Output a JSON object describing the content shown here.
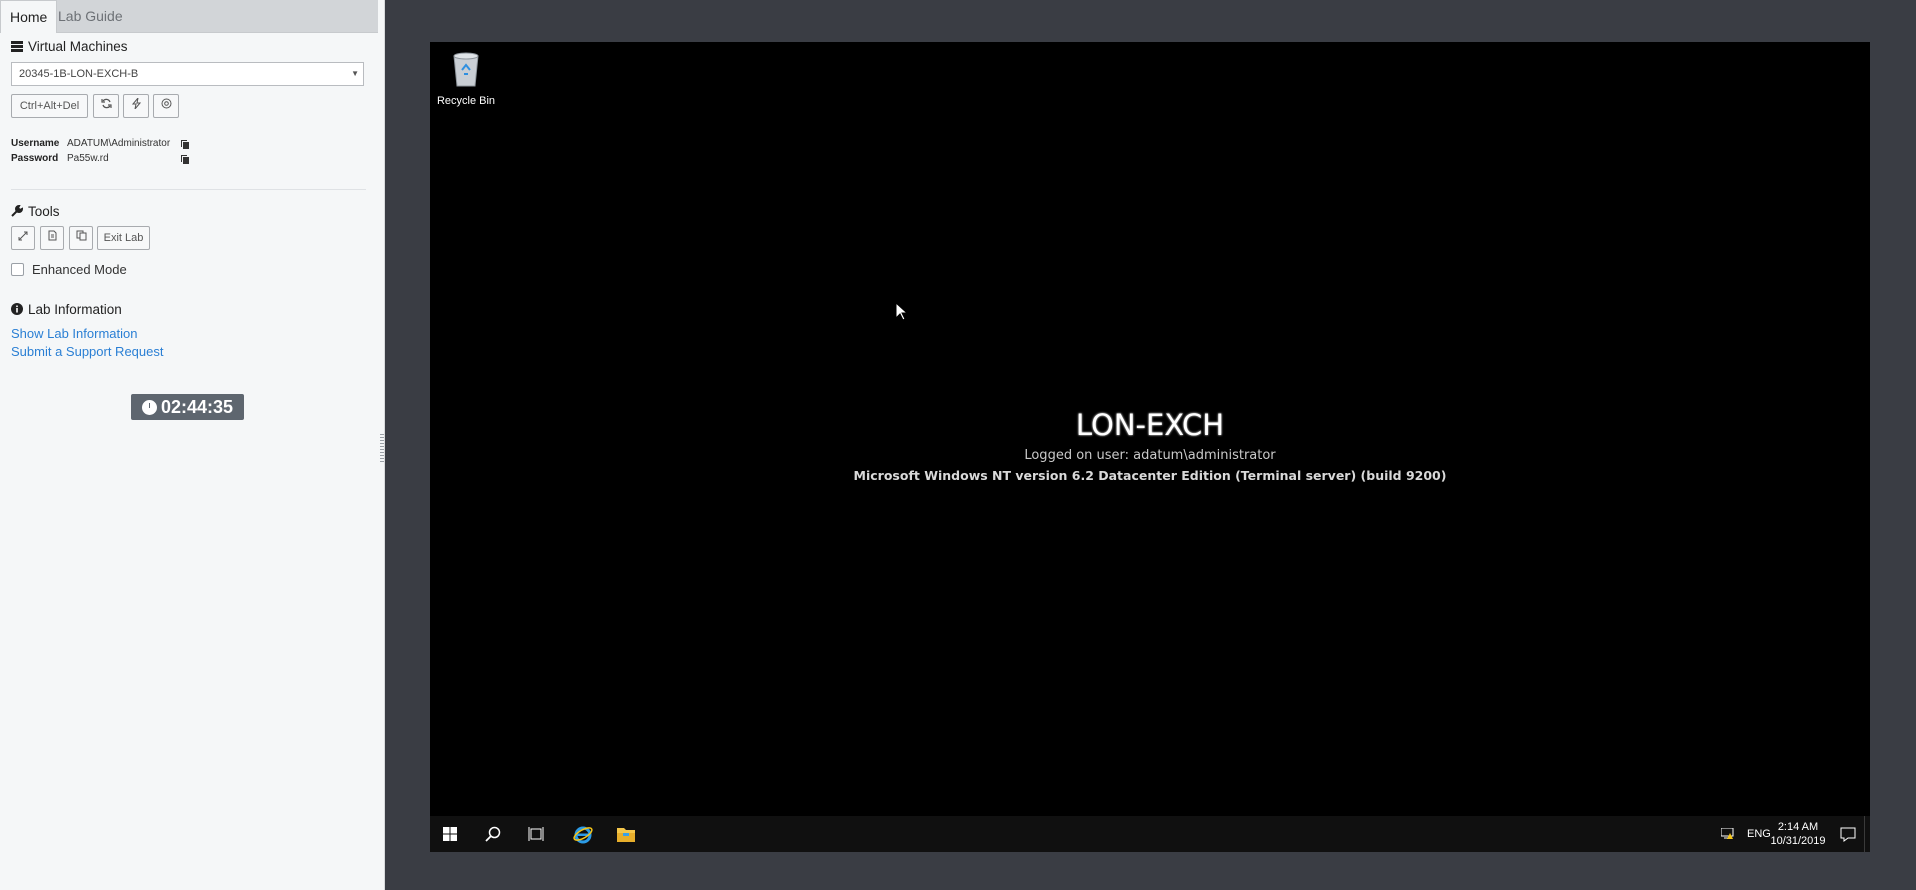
{
  "tabs": {
    "home": "Home",
    "lab_guide": "Lab Guide"
  },
  "virtual_machines": {
    "title": "Virtual Machines",
    "selected_vm": "20345-1B-LON-EXCH-B",
    "ctrl_alt_del": "Ctrl+Alt+Del",
    "icons": [
      "refresh-icon",
      "power-icon",
      "revert-icon"
    ]
  },
  "credentials": {
    "username_label": "Username",
    "username_value": "ADATUM\\Administrator",
    "password_label": "Password",
    "password_value": "Pa55w.rd"
  },
  "tools": {
    "title": "Tools",
    "icons": [
      "fullscreen-icon",
      "document-icon",
      "clipboard-icon"
    ],
    "exit_lab": "Exit Lab",
    "enhanced_mode": "Enhanced Mode"
  },
  "lab_info": {
    "title": "Lab Information",
    "show_info": "Show Lab Information",
    "support": "Submit a Support Request"
  },
  "timer": "02:44:35",
  "desktop": {
    "recycle_bin": "Recycle Bin",
    "hostname": "LON-EXCH",
    "logged_on": "Logged on user: adatum\\administrator",
    "os_info": "Microsoft Windows NT version 6.2 Datacenter Edition (Terminal server)  (build 9200)"
  },
  "taskbar": {
    "language": "ENG",
    "time": "2:14 AM",
    "date": "10/31/2019"
  },
  "colors": {
    "page_background": "#3a3d44",
    "panel_background": "#f5f7f8",
    "link": "#2a7fd4",
    "timer_background": "#5e666f",
    "taskbar": "#101010"
  }
}
